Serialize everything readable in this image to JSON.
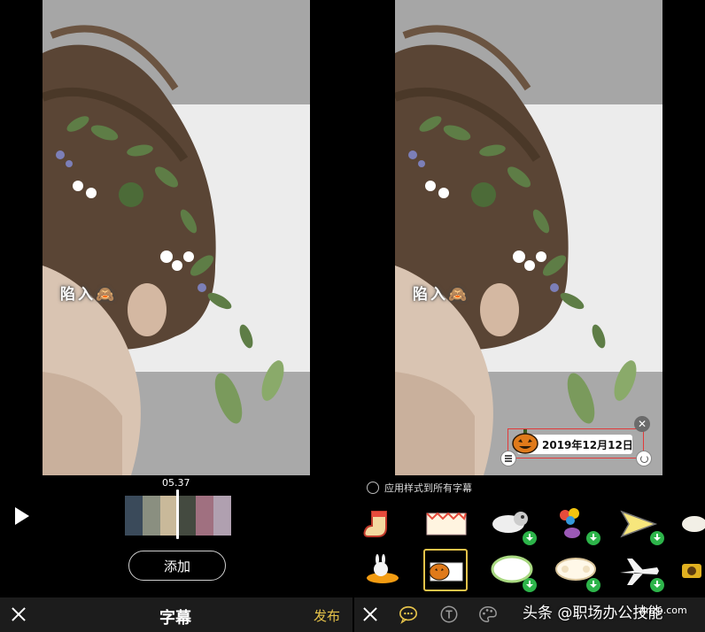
{
  "left_screen": {
    "video": {
      "caption": "陷入🙈"
    },
    "timecode": "05.37",
    "add_button": "添加",
    "bottom_bar": {
      "title": "字幕",
      "publish": "发布"
    }
  },
  "right_screen": {
    "video": {
      "caption": "陷入🙈"
    },
    "subtitle_overlay": {
      "text": "2019年12月12日"
    },
    "apply_all_label": "应用样式到所有字幕",
    "stickers": [
      {
        "name": "sock-sticker",
        "downloaded": true
      },
      {
        "name": "bunting-banner-sticker",
        "downloaded": true
      },
      {
        "name": "cloud-animal-sticker",
        "downloaded": false
      },
      {
        "name": "balloon-bird-sticker",
        "downloaded": false
      },
      {
        "name": "paper-plane-sticker",
        "downloaded": false
      },
      {
        "name": "sheep-sticker",
        "downloaded": true
      },
      {
        "name": "rabbit-carrot-sticker",
        "downloaded": true
      },
      {
        "name": "pumpkin-sticker",
        "downloaded": true,
        "selected": true
      },
      {
        "name": "speech-bubble-sticker",
        "downloaded": false
      },
      {
        "name": "sheep-cloud-sticker",
        "downloaded": false
      },
      {
        "name": "airplane-sticker",
        "downloaded": false
      },
      {
        "name": "camera-sticker",
        "downloaded": true
      }
    ],
    "watermark": "头条 @职场办公技能",
    "watermark_site": "dnzp.com"
  },
  "colors": {
    "accent": "#e6c34a",
    "selection_border": "#e23a3a",
    "download_badge": "#2db44a",
    "bar_bg": "#1c1c1c"
  }
}
